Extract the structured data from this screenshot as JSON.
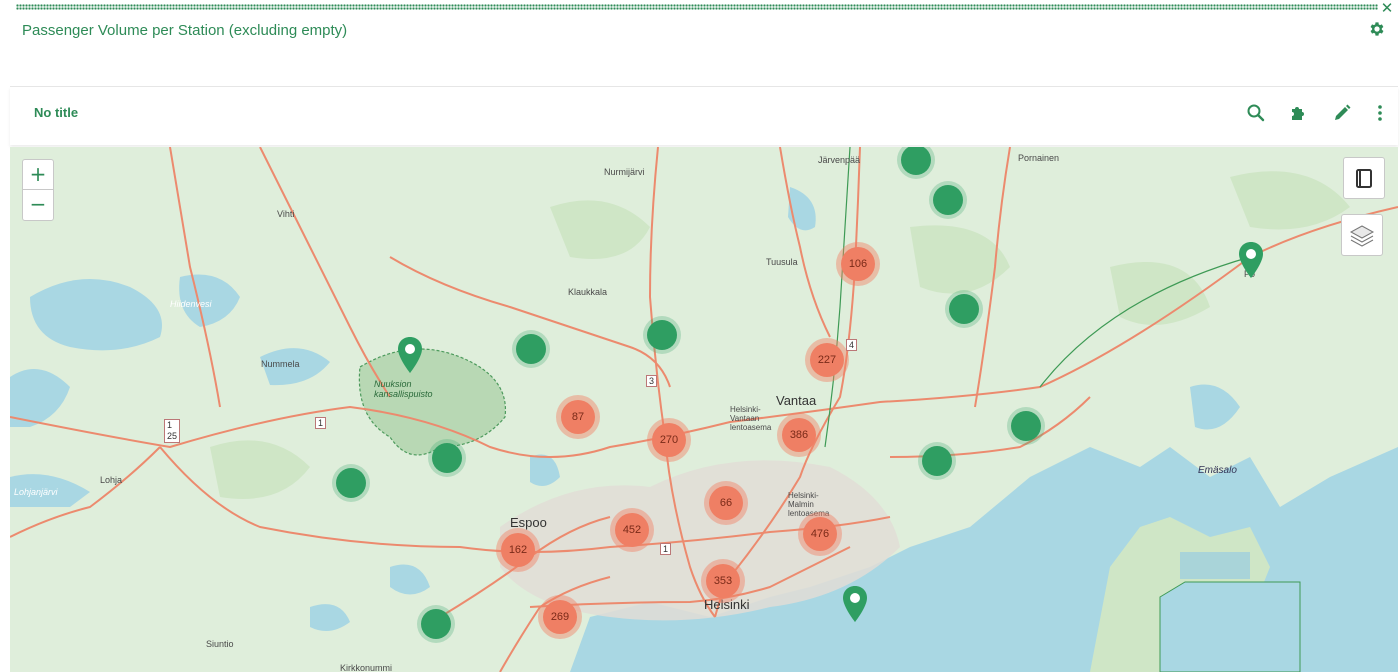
{
  "panel": {
    "title": "Passenger Volume per Station (excluding empty)",
    "close_icon": "close-icon",
    "settings_icon": "gear-icon"
  },
  "widget": {
    "title": "No title",
    "tools": [
      "search-icon",
      "puzzle-icon",
      "pencil-icon",
      "more-vertical-icon"
    ]
  },
  "map_controls": {
    "zoom_in": "+",
    "zoom_out": "−",
    "legend_icon": "legend-book-icon",
    "layers_icon": "layers-icon"
  },
  "colors": {
    "accent": "#2e8b57",
    "cluster": "#ef7f64",
    "station": "#2f9e62",
    "sea": "#a9d7e3",
    "land": "#dfeedb",
    "road": "#ec8a6e"
  },
  "places": {
    "jarvenpaa": "Järvenpää",
    "pornainen": "Pornainen",
    "nurmijarvi": "Nurmijärvi",
    "vihti": "Vihti",
    "tuusula": "Tuusula",
    "klaukkala": "Klaukkala",
    "porvoo": "Po",
    "nummela": "Nummela",
    "nuuksio1": "Nuuksion",
    "nuuksio2": "kansallispuisto",
    "vantaa": "Vantaa",
    "airport1": "Helsinki-",
    "airport2": "Vantaan",
    "airport3": "lentoasema",
    "malmi1": "Helsinki-",
    "malmi2": "Malmin",
    "malmi3": "lentoasema",
    "lohja": "Lohja",
    "espoo": "Espoo",
    "helsinki": "Helsinki",
    "emasalo": "Emäsalo",
    "siuntio": "Siuntio",
    "kirkkonummi": "Kirkkonummi",
    "lohjanjarvi": "Lohjanjärvi",
    "hiidenvesi": "Hiidenvesi"
  },
  "road_shields": {
    "r4": "4",
    "r3": "3",
    "r1a": "1",
    "r25a": "1",
    "r25b": "25",
    "r1b": "1",
    "r1c": "1"
  },
  "clusters": [
    {
      "label": "106"
    },
    {
      "label": "227"
    },
    {
      "label": "87"
    },
    {
      "label": "270"
    },
    {
      "label": "386"
    },
    {
      "label": "66"
    },
    {
      "label": "452"
    },
    {
      "label": "476"
    },
    {
      "label": "162"
    },
    {
      "label": "353"
    },
    {
      "label": "269"
    }
  ]
}
